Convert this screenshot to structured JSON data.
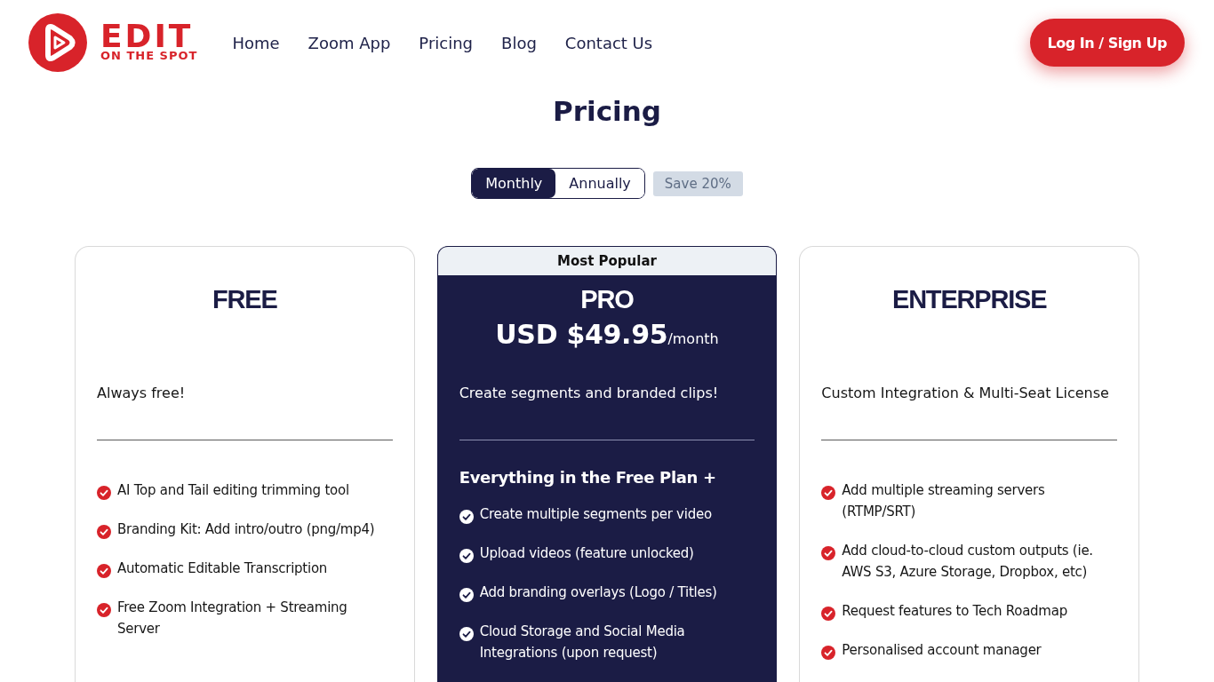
{
  "brand": {
    "name": "EDIT",
    "tagline": "ON THE SPOT"
  },
  "nav": [
    {
      "label": "Home"
    },
    {
      "label": "Zoom App"
    },
    {
      "label": "Pricing"
    },
    {
      "label": "Blog"
    },
    {
      "label": "Contact Us"
    }
  ],
  "login_button": "Log In / Sign Up",
  "page_title": "Pricing",
  "billing": {
    "options": [
      {
        "label": "Monthly",
        "selected": true
      },
      {
        "label": "Annually",
        "selected": false
      }
    ],
    "discount_badge": "Save 20%"
  },
  "plans": [
    {
      "name": "FREE",
      "featured": false,
      "description": "Always free!",
      "features": [
        "AI Top and Tail editing trimming tool",
        "Branding Kit: Add intro/outro (png/mp4)",
        "Automatic Editable Transcription",
        "Free Zoom Integration + Streaming Server"
      ]
    },
    {
      "name": "PRO",
      "featured": true,
      "badge": "Most Popular",
      "price": "USD $49.95",
      "period": "/month",
      "description": "Create segments and branded clips!",
      "features_heading": "Everything in the Free Plan +",
      "features": [
        "Create multiple segments per video",
        "Upload videos (feature unlocked)",
        "Add branding overlays (Logo / Titles)",
        "Cloud Storage and Social Media Integrations (upon request)"
      ]
    },
    {
      "name": "ENTERPRISE",
      "featured": false,
      "description": "Custom Integration & Multi-Seat License",
      "features": [
        "Add multiple streaming servers (RTMP/SRT)",
        "Add cloud-to-cloud custom outputs (ie. AWS S3, Azure Storage, Dropbox, etc)",
        "Request features to Tech Roadmap",
        "Personalised account manager"
      ]
    }
  ]
}
